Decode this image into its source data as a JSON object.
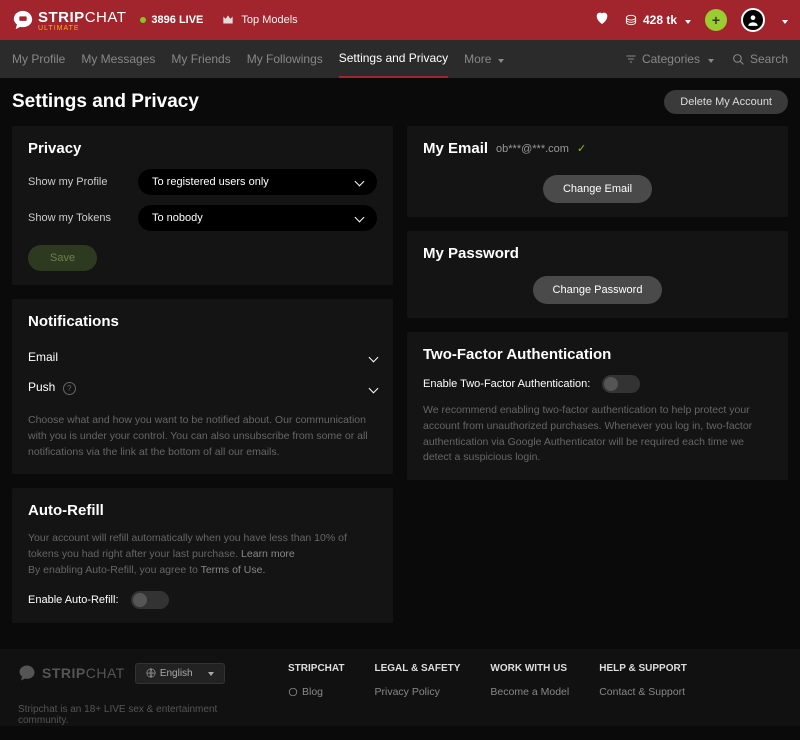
{
  "topbar": {
    "brand_main": "STRIP",
    "brand_sub": "CHAT",
    "brand_tag": "ULTIMATE",
    "live_count": "3896 LIVE",
    "top_models": "Top Models",
    "tokens": "428 tk"
  },
  "nav": {
    "items": [
      "My Profile",
      "My Messages",
      "My Friends",
      "My Followings",
      "Settings and Privacy",
      "More"
    ],
    "categories": "Categories",
    "search": "Search"
  },
  "page": {
    "title": "Settings and Privacy",
    "delete": "Delete My Account"
  },
  "privacy": {
    "title": "Privacy",
    "profile_label": "Show my Profile",
    "profile_value": "To registered users only",
    "tokens_label": "Show my Tokens",
    "tokens_value": "To nobody",
    "save": "Save"
  },
  "notifications": {
    "title": "Notifications",
    "email": "Email",
    "push": "Push",
    "note": "Choose what and how you want to be notified about. Our communication with you is under your control. You can also unsubscribe from some or all notifications via the link at the bottom of all our emails."
  },
  "autorefill": {
    "title": "Auto-Refill",
    "note1": "Your account will refill automatically when you have less than 10% of tokens you had right after your last purchase. ",
    "learn": "Learn more",
    "note2": "By enabling Auto-Refill, you agree to ",
    "terms": "Terms of Use.",
    "toggle_label": "Enable Auto-Refill:"
  },
  "email": {
    "title": "My Email",
    "value": "ob***@***.com",
    "change": "Change Email"
  },
  "password": {
    "title": "My Password",
    "change": "Change Password"
  },
  "tfa": {
    "title": "Two-Factor Authentication",
    "toggle_label": "Enable Two-Factor Authentication:",
    "note": "We recommend enabling two-factor authentication to help protect your account from unauthorized purchases. Whenever you log in, two-factor authentication via Google Authenticator will be required each time we detect a suspicious login."
  },
  "footer": {
    "lang": "English",
    "tag": "Stripchat is an 18+ LIVE sex & entertainment community.",
    "cols": [
      {
        "title": "STRIPCHAT",
        "links": [
          "Blog"
        ]
      },
      {
        "title": "LEGAL & SAFETY",
        "links": [
          "Privacy Policy"
        ]
      },
      {
        "title": "WORK WITH US",
        "links": [
          "Become a Model"
        ]
      },
      {
        "title": "HELP & SUPPORT",
        "links": [
          "Contact & Support"
        ]
      }
    ]
  }
}
